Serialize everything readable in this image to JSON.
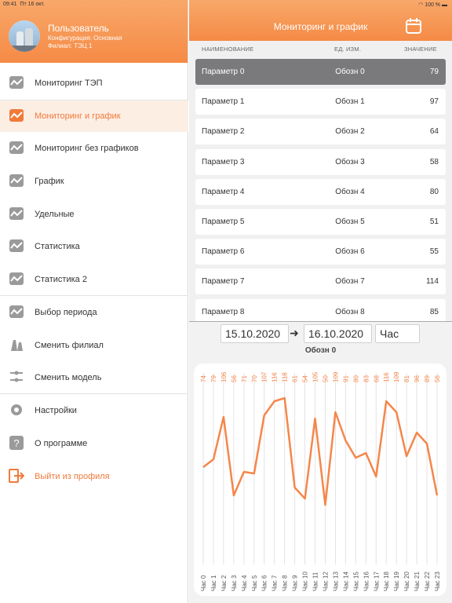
{
  "status": {
    "time": "09:41",
    "date": "Пт 16 окт.",
    "battery": "100 %"
  },
  "profile": {
    "name": "Пользователь",
    "config": "Конфигурация: Основная",
    "branch": "Филиал: ТЭЦ 1"
  },
  "menu": [
    {
      "label": "Мониторинг ТЭП",
      "icon": "monitor-icon"
    },
    {
      "label": "Мониторинг и график",
      "icon": "monitor-icon",
      "active": true
    },
    {
      "label": "Мониторинг без графиков",
      "icon": "monitor-icon"
    },
    {
      "label": "График",
      "icon": "monitor-icon"
    },
    {
      "label": "Удельные",
      "icon": "monitor-icon"
    },
    {
      "label": "Статистика",
      "icon": "monitor-icon"
    },
    {
      "label": "Статистика 2",
      "icon": "monitor-icon"
    },
    {
      "label": "Выбор периода",
      "icon": "monitor-icon"
    },
    {
      "label": "Сменить филиал",
      "icon": "plant-icon"
    },
    {
      "label": "Сменить модель",
      "icon": "model-icon"
    },
    {
      "label": "Настройки",
      "icon": "gear-icon"
    },
    {
      "label": "О программе",
      "icon": "question-icon"
    },
    {
      "label": "Выйти из профиля",
      "icon": "logout-icon"
    }
  ],
  "header": {
    "title": "Мониторинг и график"
  },
  "table": {
    "columns": [
      "НАИМЕНОВАНИЕ",
      "ЕД. ИЗМ.",
      "ЗНАЧЕНИЕ"
    ],
    "rows": [
      {
        "name": "Параметр 0",
        "unit": "Обозн 0",
        "value": "79"
      },
      {
        "name": "Параметр 1",
        "unit": "Обозн 1",
        "value": "97"
      },
      {
        "name": "Параметр 2",
        "unit": "Обозн 2",
        "value": "64"
      },
      {
        "name": "Параметр 3",
        "unit": "Обозн 3",
        "value": "58"
      },
      {
        "name": "Параметр 4",
        "unit": "Обозн 4",
        "value": "80"
      },
      {
        "name": "Параметр 5",
        "unit": "Обозн 5",
        "value": "51"
      },
      {
        "name": "Параметр 6",
        "unit": "Обозн 6",
        "value": "55"
      },
      {
        "name": "Параметр 7",
        "unit": "Обозн 7",
        "value": "114"
      },
      {
        "name": "Параметр 8",
        "unit": "Обозн 8",
        "value": "85"
      }
    ]
  },
  "period": {
    "from": "15.10.2020",
    "to": "16.10.2020",
    "step": "Час"
  },
  "chart_data": {
    "type": "line",
    "title": "Обозн 0",
    "categories": [
      "Час 0",
      "Час 1",
      "Час 2",
      "Час 3",
      "Час 4",
      "Час 5",
      "Час 6",
      "Час 7",
      "Час 8",
      "Час 9",
      "Час 10",
      "Час 11",
      "Час 12",
      "Час 13",
      "Час 14",
      "Час 15",
      "Час 16",
      "Час 17",
      "Час 18",
      "Час 19",
      "Час 20",
      "Час 21",
      "Час 22",
      "Час 23"
    ],
    "values": [
      74,
      79,
      106,
      56,
      71,
      70,
      107,
      116,
      118,
      61,
      54,
      105,
      50,
      109,
      91,
      80,
      83,
      68,
      116,
      109,
      81,
      96,
      89,
      56
    ],
    "ylim": [
      40,
      125
    ],
    "color": "#f5864a"
  }
}
